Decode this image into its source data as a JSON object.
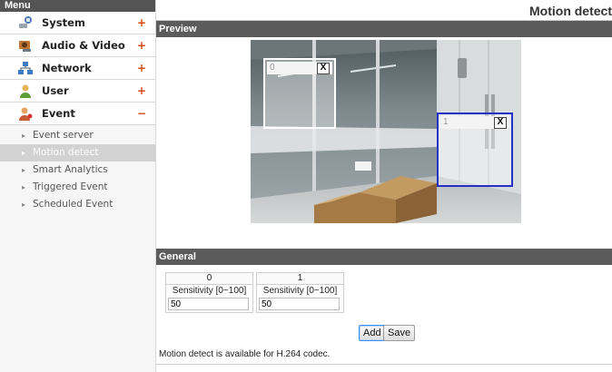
{
  "sidebar": {
    "header": "Menu",
    "items": [
      {
        "label": "System",
        "sign": "+",
        "icon": "wrench-icon",
        "color": "#4a74b6"
      },
      {
        "label": "Audio & Video",
        "sign": "+",
        "icon": "camera-icon",
        "color": "#c0752e"
      },
      {
        "label": "Network",
        "sign": "+",
        "icon": "network-icon",
        "color": "#3d7bc4"
      },
      {
        "label": "User",
        "sign": "+",
        "icon": "user-icon",
        "color": "#5b9e3a"
      },
      {
        "label": "Event",
        "sign": "−",
        "icon": "event-icon",
        "color": "#c65a35"
      }
    ],
    "subitems": [
      {
        "label": "Event server",
        "active": false
      },
      {
        "label": "Motion detect",
        "active": true
      },
      {
        "label": "Smart Analytics",
        "active": false
      },
      {
        "label": "Triggered Event",
        "active": false
      },
      {
        "label": "Scheduled Event",
        "active": false
      }
    ]
  },
  "page": {
    "title": "Motion detect",
    "preview_label": "Preview",
    "general_label": "General",
    "regions": [
      {
        "id": "0",
        "close": "X",
        "selected": false
      },
      {
        "id": "1",
        "close": "X",
        "selected": true
      }
    ],
    "sensitivity": [
      {
        "index": "0",
        "label": "Sensitivity [0~100]",
        "value": "50"
      },
      {
        "index": "1",
        "label": "Sensitivity [0~100]",
        "value": "50"
      }
    ],
    "buttons": {
      "add": "Add",
      "save": "Save"
    },
    "note": "Motion detect is available for H.264 codec."
  },
  "colors": {
    "accent": "#d24a19",
    "section_bar": "#5b5b5b",
    "selected_region_border": "#2430c8"
  }
}
